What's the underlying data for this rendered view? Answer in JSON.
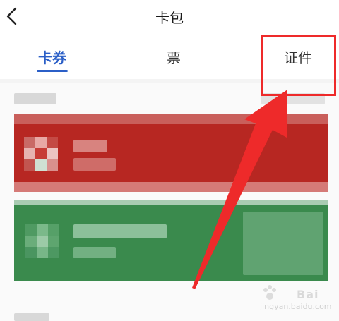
{
  "header": {
    "title": "卡包",
    "back_icon": "chevron-left-icon"
  },
  "tabs": [
    {
      "label": "卡券",
      "active": true
    },
    {
      "label": "票",
      "active": false
    },
    {
      "label": "证件",
      "active": false
    }
  ],
  "colors": {
    "accent": "#2b5fc7",
    "red_card": "#b72722",
    "green_card": "#3a8a4d",
    "annotation": "#ee2a2a"
  },
  "watermark": {
    "text": "Bai",
    "url": "jingyan.baidu.com"
  }
}
